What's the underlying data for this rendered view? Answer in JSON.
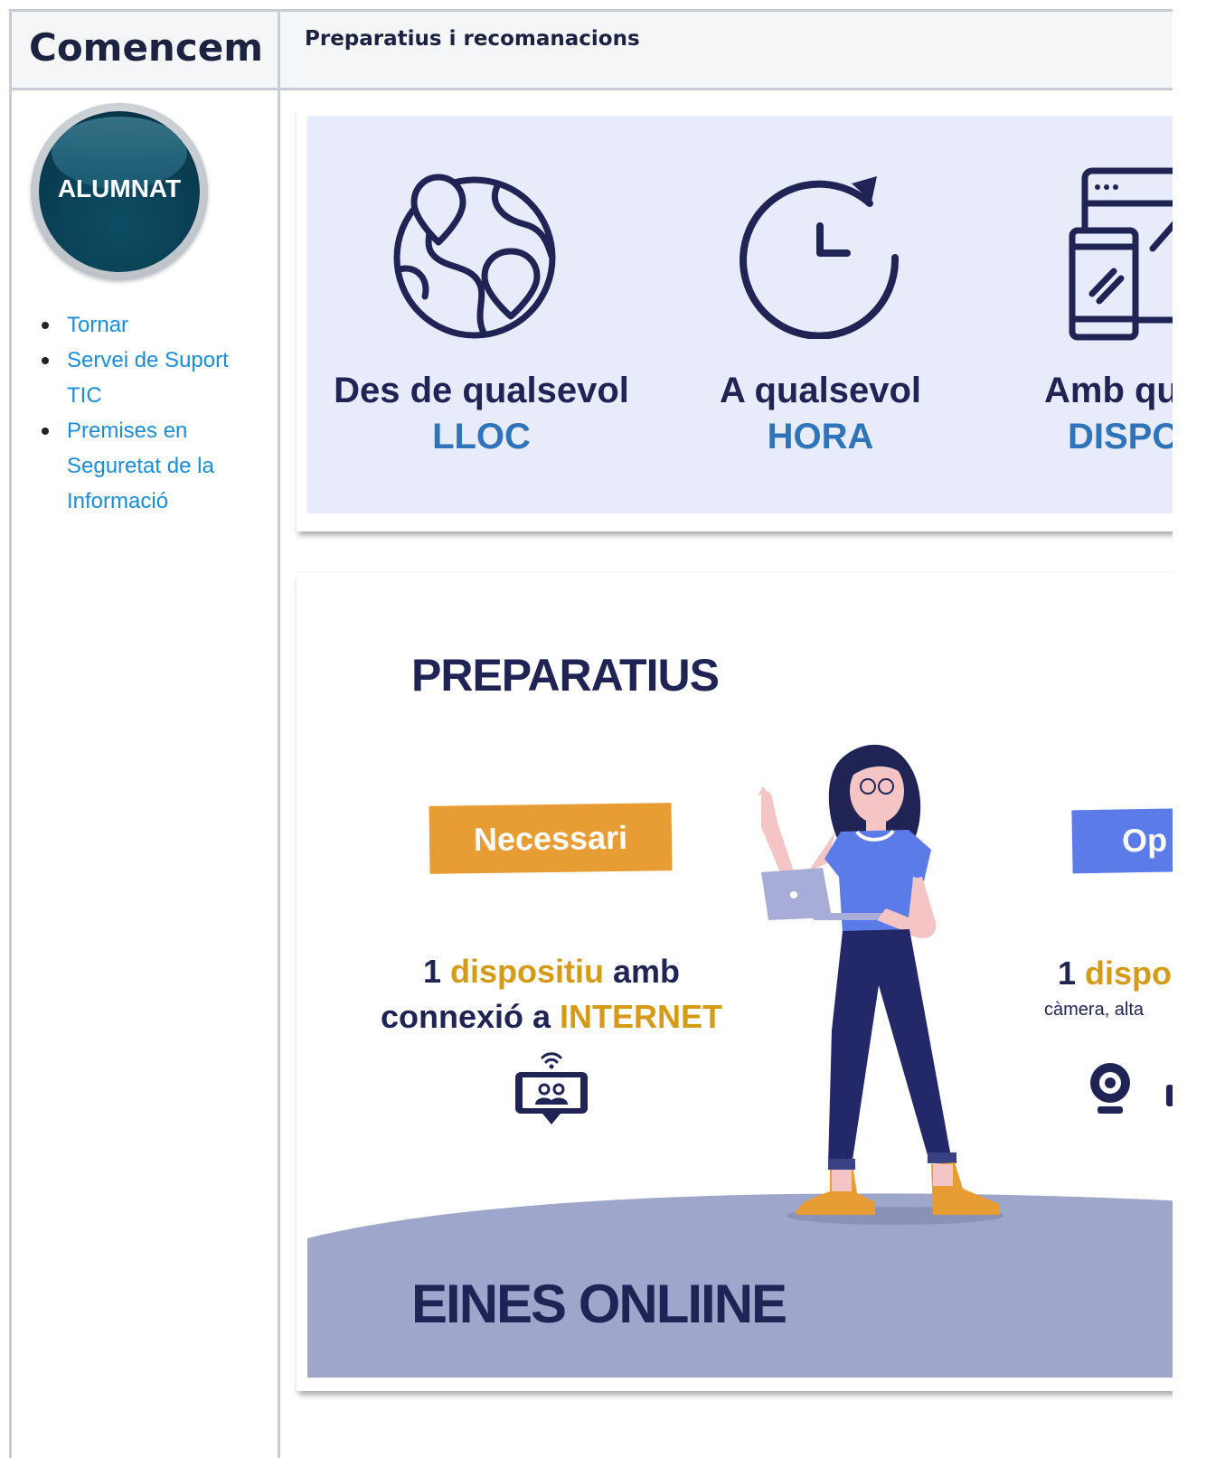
{
  "sidebar": {
    "title": "Comencem",
    "badge_text": "ALUMNAT",
    "links": [
      "Tornar",
      "Servei de Suport TIC",
      "Premises en Seguretat de la Informació"
    ]
  },
  "main": {
    "title": "Preparatius i recomanacions"
  },
  "features": [
    {
      "line1": "Des de qualsevol",
      "line2": "LLOC",
      "icon": "globe-pins-icon"
    },
    {
      "line1": "A qualsevol",
      "line2": "HORA",
      "icon": "clock-icon"
    },
    {
      "line1": "Amb qu",
      "line2": "DISPO",
      "icon": "devices-icon"
    }
  ],
  "prep": {
    "title": "PREPARATIUS",
    "necessary_label": "Necessari",
    "optional_label": "Op",
    "necessary_parts": [
      "1 ",
      "dispositiu",
      " amb",
      "connexió a ",
      "INTERNET"
    ],
    "optional_parts": [
      "1 ",
      "dispo"
    ],
    "optional_sub": "càmera, alta",
    "bottom_title": "EINES ONLIINE"
  },
  "colors": {
    "navy": "#1f2455",
    "gold": "#d59b17",
    "orange_tag": "#e89c34",
    "blue_tag": "#5b7be8",
    "light_blue_bg": "#e8ebfa",
    "link": "#1a8cd8",
    "ground": "#9ea6cb"
  }
}
